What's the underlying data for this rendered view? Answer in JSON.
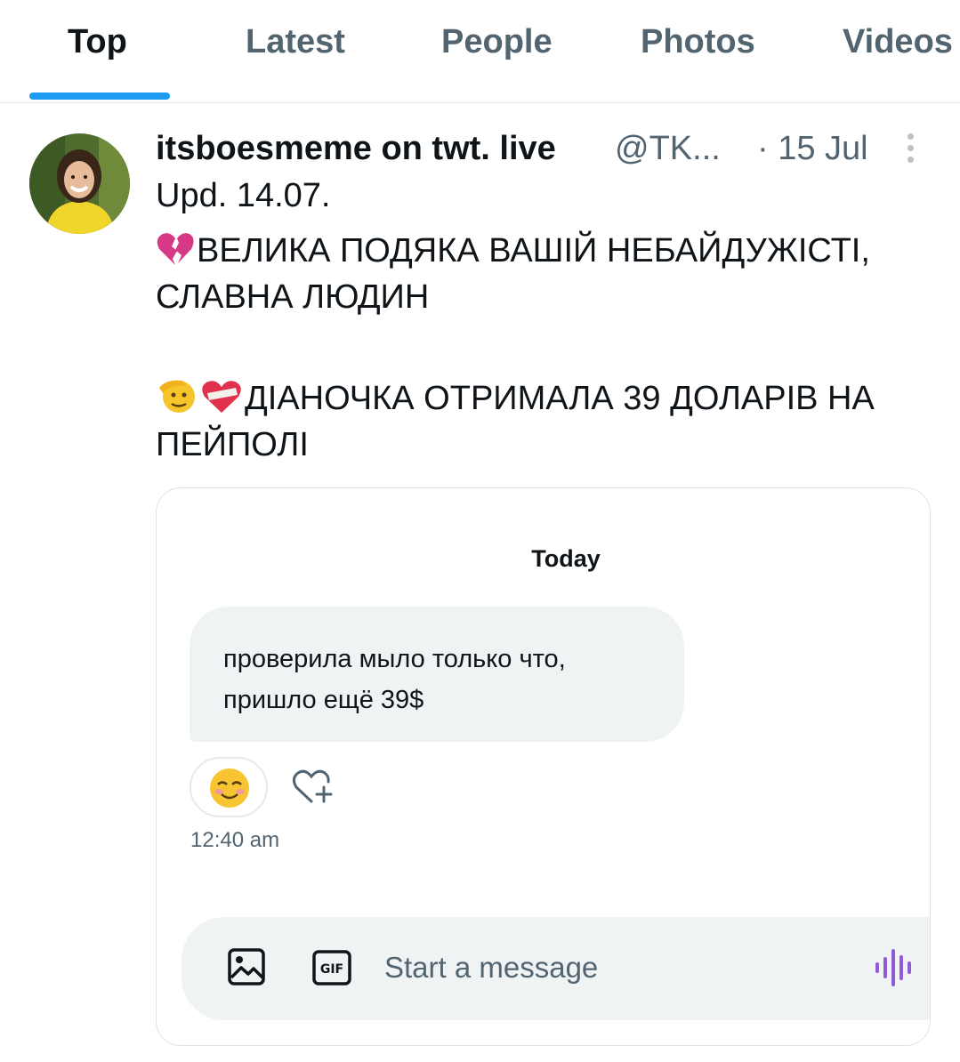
{
  "tabs": {
    "items": [
      {
        "label": "Top"
      },
      {
        "label": "Latest"
      },
      {
        "label": "People"
      },
      {
        "label": "Photos"
      },
      {
        "label": "Videos"
      }
    ],
    "active": "Top",
    "indicator_color": "#1d9bf0"
  },
  "tweet": {
    "display_name": "itsboesmeme on twt. live",
    "handle": "@TK...",
    "date": "· 15 Jul",
    "lines": [
      "Upd. 14.07.",
      "ВЕЛИКА ПОДЯКА ВАШІЙ НЕБАЙДУЖІСТІ,",
      "СЛАВНА ЛЮДИН",
      "ДІАНОЧКА ОТРИМАЛА 39 ДОЛАРІВ НА",
      "ПЕЙПОЛІ"
    ],
    "icons": [
      "broken-heart-icon",
      "salute-emoji-icon",
      "mending-heart-icon",
      "more-icon"
    ]
  },
  "media": {
    "date_label": "Today",
    "message_lines": [
      "проверила мыло только что,",
      "пришло ещё 39$"
    ],
    "reaction_emoji": "☺️",
    "time": "12:40 am",
    "composer": {
      "placeholder": "Start a message",
      "gif_label": "GIF",
      "accent_color": "#8f5bd8"
    }
  }
}
